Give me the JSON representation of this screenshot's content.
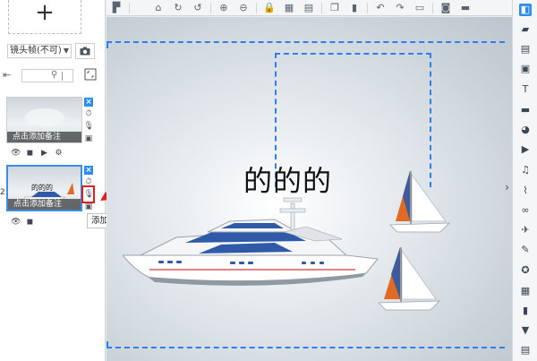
{
  "left_panel": {
    "add_scene_label": "+",
    "lens_select": "镜头帧(不可)",
    "scenes": [
      {
        "caption": "点击添加备注",
        "title": ""
      },
      {
        "caption": "点击添加备注",
        "title": "的的的"
      }
    ],
    "scene_number": "2"
  },
  "tooltip": "添加声音跟字幕",
  "canvas": {
    "text": "的的的"
  },
  "colors": {
    "accent": "#2d8cf0",
    "highlight": "#e02020"
  }
}
